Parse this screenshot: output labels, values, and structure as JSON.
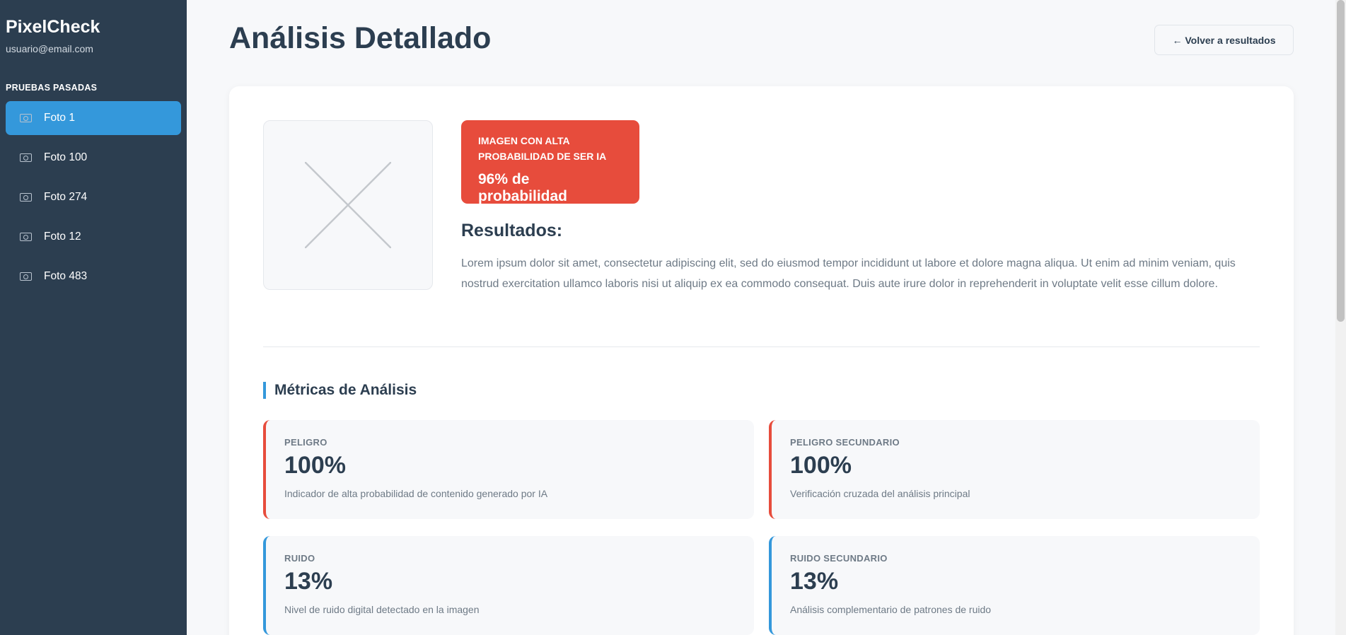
{
  "app": {
    "name": "PixelCheck",
    "user_email": "usuario@email.com"
  },
  "sidebar": {
    "section_title": "PRUEBAS PASADAS",
    "items": [
      {
        "label": "Foto 1",
        "active": true
      },
      {
        "label": "Foto 100"
      },
      {
        "label": "Foto 274"
      },
      {
        "label": "Foto 12"
      },
      {
        "label": "Foto 483"
      }
    ]
  },
  "header": {
    "title": "Análisis Detallado",
    "back_label": "← Volver a resultados"
  },
  "verdict": {
    "label": "IMAGEN CON ALTA PROBABILIDAD DE SER IA",
    "value": "96% de probabilidad",
    "color": "#e74c3c"
  },
  "results": {
    "title": "Resultados:",
    "text": "Lorem ipsum dolor sit amet, consectetur adipiscing elit, sed do eiusmod tempor incididunt ut labore et dolore magna aliqua. Ut enim ad minim veniam, quis nostrud exercitation ullamco laboris nisi ut aliquip ex ea commodo consequat. Duis aute irure dolor in reprehenderit in voluptate velit esse cillum dolore."
  },
  "metrics": {
    "title": "Métricas de Análisis",
    "items": [
      {
        "label": "PELIGRO",
        "value": "100%",
        "desc": "Indicador de alta probabilidad de contenido generado por IA",
        "accent": "#e74c3c"
      },
      {
        "label": "PELIGRO SECUNDARIO",
        "value": "100%",
        "desc": "Verificación cruzada del análisis principal",
        "accent": "#e74c3c"
      },
      {
        "label": "RUIDO",
        "value": "13%",
        "desc": "Nivel de ruido digital detectado en la imagen",
        "accent": "#3498db"
      },
      {
        "label": "RUIDO SECUNDARIO",
        "value": "13%",
        "desc": "Análisis complementario de patrones de ruido",
        "accent": "#3498db"
      }
    ]
  },
  "icons": {
    "nav": "camera-icon",
    "thumbnail": "image-placeholder-icon"
  }
}
